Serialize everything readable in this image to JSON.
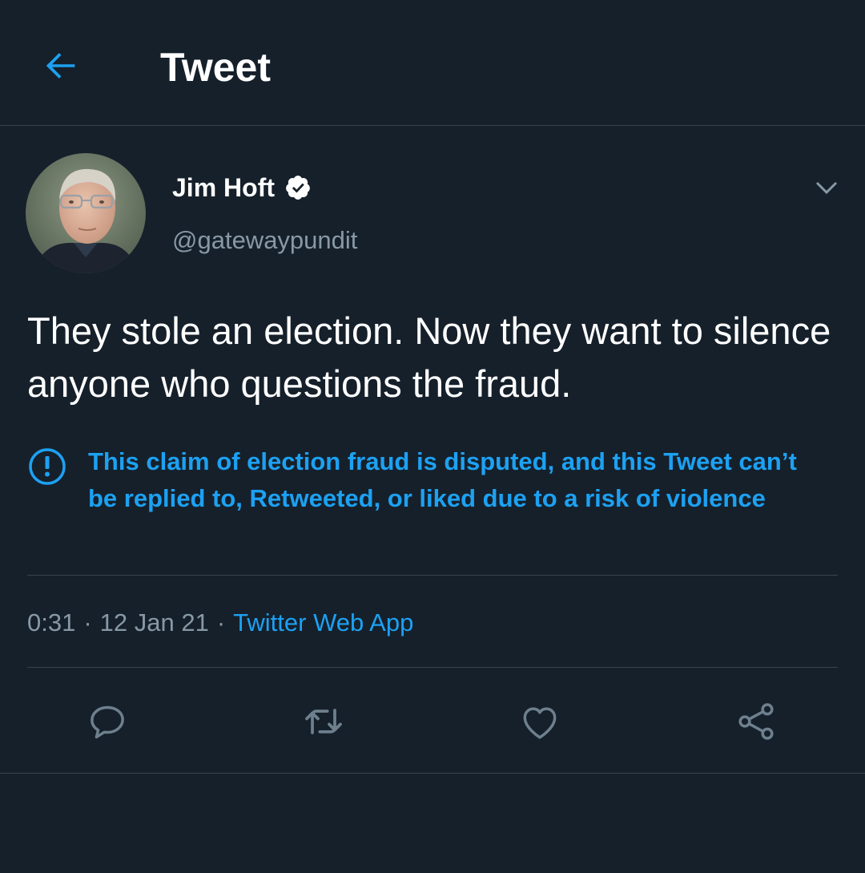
{
  "header": {
    "back_icon": "arrow-left-icon",
    "title": "Tweet"
  },
  "tweet": {
    "author": {
      "display_name": "Jim Hoft",
      "verified_icon": "verified-badge-icon",
      "handle": "@gatewaypundit",
      "avatar_icon": "user-avatar"
    },
    "menu_icon": "chevron-down-icon",
    "text": "They stole an election. Now they want to silence anyone who questions the fraud.",
    "notice": {
      "icon": "exclamation-circle-icon",
      "text": "This claim of election fraud is disputed, and this Tweet can’t be replied to, Retweeted, or liked due to a risk of violence"
    },
    "meta": {
      "time": "0:31",
      "date": "12 Jan 21",
      "separator": "·",
      "source": "Twitter Web App"
    },
    "actions": [
      {
        "name": "reply",
        "icon": "reply-icon"
      },
      {
        "name": "retweet",
        "icon": "retweet-icon"
      },
      {
        "name": "like",
        "icon": "heart-icon"
      },
      {
        "name": "share",
        "icon": "share-icon"
      }
    ]
  },
  "colors": {
    "background": "#15202b",
    "accent": "#1da1f2",
    "secondary_text": "#8899a6",
    "divider": "#38444d",
    "icon_gray": "#6e7f8d"
  }
}
